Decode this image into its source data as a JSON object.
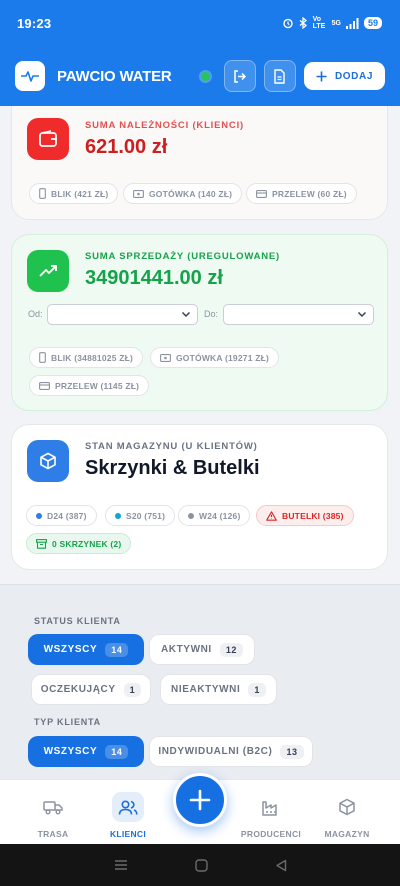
{
  "status_bar": {
    "time": "19:23",
    "network": "Vo LTE",
    "signal": "5G",
    "battery": "59"
  },
  "header": {
    "app_title": "PAWCIO WATER",
    "add_label": "DODAJ"
  },
  "debt_card": {
    "label": "SUMA NALEŻNOŚCI (KLIENCI)",
    "value": "621.00 zł",
    "chips": [
      "BLIK (421 ZŁ)",
      "GOTÓWKA (140 ZŁ)",
      "PRZELEW (60 ZŁ)"
    ]
  },
  "sales_card": {
    "label": "SUMA SPRZEDAŻY (UREGULOWANE)",
    "value": "34901441.00 zł",
    "from_label": "Od:",
    "to_label": "Do:",
    "from_value": "",
    "to_value": "",
    "chips": [
      "BLIK (34881025 ZŁ)",
      "GOTÓWKA (19271 ZŁ)",
      "PRZELEW (1145 ZŁ)"
    ]
  },
  "stock_card": {
    "label": "STAN MAGAZYNU (U KLIENTÓW)",
    "value": "Skrzynki & Butelki",
    "chips": [
      "D24 (387)",
      "S20 (751)",
      "W24 (126)",
      "BUTELKI (385)",
      "0 SKRZYNEK (2)"
    ]
  },
  "filters": {
    "status_label": "STATUS KLIENTA",
    "status_options": [
      {
        "label": "WSZYSCY",
        "count": "14"
      },
      {
        "label": "AKTYWNI",
        "count": "12"
      },
      {
        "label": "OCZEKUJĄCY",
        "count": "1"
      },
      {
        "label": "NIEAKTYWNI",
        "count": "1"
      }
    ],
    "type_label": "TYP KLIENTA",
    "type_options": [
      {
        "label": "WSZYSCY",
        "count": "14"
      },
      {
        "label": "INDYWIDUALNI (B2C)",
        "count": "13"
      }
    ]
  },
  "bottom_nav": {
    "items": [
      "TRASA",
      "KLIENCI",
      "PRODUCENCI",
      "MAGAZYN"
    ]
  },
  "colors": {
    "primary": "#1c7bea",
    "debt_red": "#cc1f1f",
    "sales_green": "#15a34a",
    "stock_blue": "#2f7de6",
    "warning_red": "#dc2626"
  },
  "icons": {
    "logo": "waveform-logo-icon",
    "logout": "logout-icon",
    "report": "document-icon",
    "add": "plus-icon",
    "debt": "wallet-icon",
    "sales": "trending-up-icon",
    "stock": "box-icon"
  }
}
